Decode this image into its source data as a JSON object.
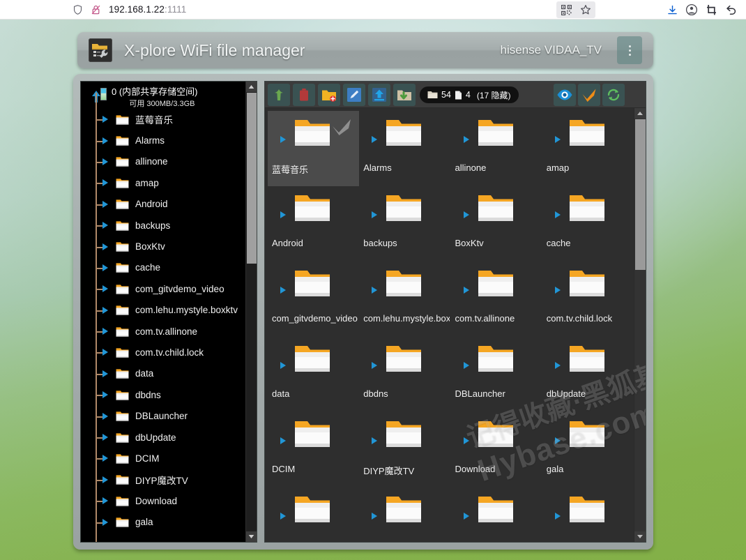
{
  "browser": {
    "url_host": "192.168.1.22",
    "url_port": ":1111",
    "icons": {
      "shield": "shield-icon",
      "lock_slash": "lock-disabled-icon",
      "qr": "qr-code-icon",
      "star": "bookmark-star-icon",
      "download": "download-icon",
      "account": "account-icon",
      "screenshot": "screenshot-crop-icon",
      "back": "undo-arrow-icon"
    }
  },
  "app": {
    "title": "X-plore WiFi file manager",
    "device": "hisense VIDAA_TV",
    "menu_icon": "overflow-menu-icon",
    "app_icon": "folder-wrench-icon"
  },
  "tree": {
    "root_label": "0 (内部共享存储空间)",
    "free_space": "可用 300MB/3.3GB",
    "items": [
      {
        "label": "蓝莓音乐"
      },
      {
        "label": "Alarms"
      },
      {
        "label": "allinone"
      },
      {
        "label": "amap"
      },
      {
        "label": "Android"
      },
      {
        "label": "backups"
      },
      {
        "label": "BoxKtv"
      },
      {
        "label": "cache"
      },
      {
        "label": "com_gitvdemo_video"
      },
      {
        "label": "com.lehu.mystyle.boxktv"
      },
      {
        "label": "com.tv.allinone"
      },
      {
        "label": "com.tv.child.lock"
      },
      {
        "label": "data"
      },
      {
        "label": "dbdns"
      },
      {
        "label": "DBLauncher"
      },
      {
        "label": "dbUpdate"
      },
      {
        "label": "DCIM"
      },
      {
        "label": "DIYP魔改TV"
      },
      {
        "label": "Download"
      },
      {
        "label": "gala"
      }
    ]
  },
  "toolbar": {
    "buttons": [
      {
        "name": "up-folder-button",
        "icon": "up-arrow-icon"
      },
      {
        "name": "delete-button",
        "icon": "trash-icon"
      },
      {
        "name": "new-folder-button",
        "icon": "folder-plus-icon"
      },
      {
        "name": "rename-button",
        "icon": "pencil-icon"
      },
      {
        "name": "upload-button",
        "icon": "upload-icon"
      },
      {
        "name": "download-button",
        "icon": "download-to-folder-icon"
      }
    ],
    "count_folders": "54",
    "count_files": "4",
    "count_hidden": "(17 隐藏)",
    "right_buttons": [
      {
        "name": "view-toggle-button",
        "icon": "eye-icon"
      },
      {
        "name": "select-all-button",
        "icon": "check-icon"
      },
      {
        "name": "refresh-button",
        "icon": "refresh-icon"
      }
    ]
  },
  "grid": {
    "items": [
      {
        "label": "蓝莓音乐",
        "selected": true
      },
      {
        "label": "Alarms",
        "selected": false
      },
      {
        "label": "allinone",
        "selected": false
      },
      {
        "label": "amap",
        "selected": false
      },
      {
        "label": "Android",
        "selected": false
      },
      {
        "label": "backups",
        "selected": false
      },
      {
        "label": "BoxKtv",
        "selected": false
      },
      {
        "label": "cache",
        "selected": false
      },
      {
        "label": "com_gitvdemo_video",
        "selected": false
      },
      {
        "label": "com.lehu.mystyle.boxktv",
        "selected": false
      },
      {
        "label": "com.tv.allinone",
        "selected": false
      },
      {
        "label": "com.tv.child.lock",
        "selected": false
      },
      {
        "label": "data",
        "selected": false
      },
      {
        "label": "dbdns",
        "selected": false
      },
      {
        "label": "DBLauncher",
        "selected": false
      },
      {
        "label": "dbUpdate",
        "selected": false
      },
      {
        "label": "DCIM",
        "selected": false
      },
      {
        "label": "DIYP魔改TV",
        "selected": false
      },
      {
        "label": "Download",
        "selected": false
      },
      {
        "label": "gala",
        "selected": false
      },
      {
        "label": "",
        "selected": false
      },
      {
        "label": "",
        "selected": false
      },
      {
        "label": "",
        "selected": false
      },
      {
        "label": "",
        "selected": false
      }
    ]
  },
  "watermark": {
    "line1": "记得收藏·黑狐基地",
    "line2": "Hybase.com"
  },
  "colors": {
    "accent_blue": "#2196d6",
    "folder_orange": "#f5a623",
    "check_orange": "#ef8c16",
    "refresh_green": "#5fbf5f",
    "trash_red": "#b83b3b"
  }
}
